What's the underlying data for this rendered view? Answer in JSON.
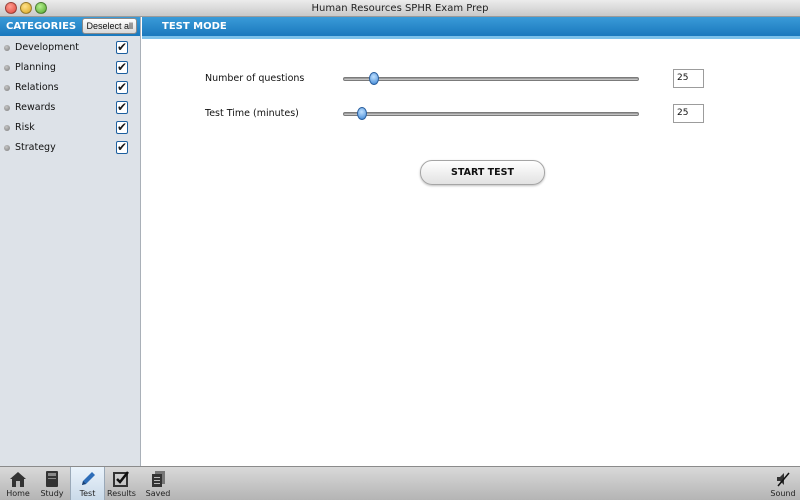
{
  "window": {
    "title": "Human Resources SPHR Exam Prep"
  },
  "sidebar": {
    "header": "CATEGORIES",
    "deselect_label": "Deselect all",
    "categories": [
      {
        "label": "Development",
        "checked": true
      },
      {
        "label": "Planning",
        "checked": true
      },
      {
        "label": "Relations",
        "checked": true
      },
      {
        "label": "Rewards",
        "checked": true
      },
      {
        "label": "Risk",
        "checked": true
      },
      {
        "label": "Strategy",
        "checked": true
      }
    ]
  },
  "main": {
    "header": "TEST MODE",
    "questions": {
      "label": "Number of questions",
      "value": "25"
    },
    "time": {
      "label": "Test Time (minutes)",
      "value": "25"
    },
    "start_label": "START TEST"
  },
  "toolbar": {
    "items": [
      {
        "label": "Home",
        "icon": "home-icon"
      },
      {
        "label": "Study",
        "icon": "book-icon"
      },
      {
        "label": "Test",
        "icon": "pencil-icon",
        "active": true
      },
      {
        "label": "Results",
        "icon": "checkbox-icon"
      },
      {
        "label": "Saved Tests",
        "icon": "documents-icon"
      }
    ],
    "sound_label": "Sound"
  },
  "colors": {
    "accent": "#1a78bd",
    "sidebar_bg": "#dde2e8"
  }
}
